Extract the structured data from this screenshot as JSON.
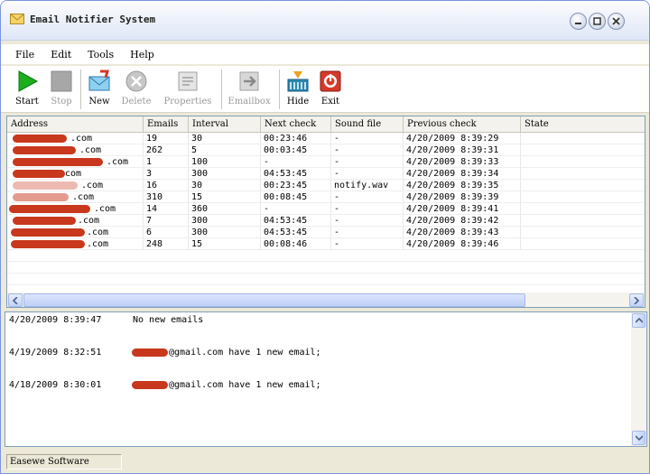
{
  "window": {
    "title": "Email Notifier System"
  },
  "menu": [
    "File",
    "Edit",
    "Tools",
    "Help"
  ],
  "toolbar": {
    "start": "Start",
    "stop": "Stop",
    "new": "New",
    "delete": "Delete",
    "properties": "Properties",
    "emailbox": "Emailbox",
    "hide": "Hide",
    "exit": "Exit"
  },
  "accounts": {
    "headers": [
      "Address",
      "Emails",
      "Interval",
      "Next check",
      "Sound file",
      "Previous check",
      "State"
    ],
    "rows": [
      {
        "address": ".com",
        "emails": "19",
        "interval": "30",
        "next": "00:23:46",
        "sound": "-",
        "prev": "4/20/2009 8:39:29",
        "state": ""
      },
      {
        "address": ".com",
        "emails": "262",
        "interval": "5",
        "next": "00:03:45",
        "sound": "-",
        "prev": "4/20/2009 8:39:31",
        "state": ""
      },
      {
        "address": ".com",
        "emails": "1",
        "interval": "100",
        "next": "-",
        "sound": "-",
        "prev": "4/20/2009 8:39:33",
        "state": ""
      },
      {
        "address": "com",
        "emails": "3",
        "interval": "300",
        "next": "04:53:45",
        "sound": "-",
        "prev": "4/20/2009 8:39:34",
        "state": ""
      },
      {
        "address": ".com",
        "emails": "16",
        "interval": "30",
        "next": "00:23:45",
        "sound": "notify.wav",
        "prev": "4/20/2009 8:39:35",
        "state": ""
      },
      {
        "address": ".com",
        "emails": "310",
        "interval": "15",
        "next": "00:08:45",
        "sound": "-",
        "prev": "4/20/2009 8:39:39",
        "state": ""
      },
      {
        "address": ".com",
        "emails": "14",
        "interval": "360",
        "next": "-",
        "sound": "-",
        "prev": "4/20/2009 8:39:41",
        "state": ""
      },
      {
        "address": ".com",
        "emails": "7",
        "interval": "300",
        "next": "04:53:45",
        "sound": "-",
        "prev": "4/20/2009 8:39:42",
        "state": ""
      },
      {
        "address": ".com",
        "emails": "6",
        "interval": "300",
        "next": "04:53:45",
        "sound": "-",
        "prev": "4/20/2009 8:39:43",
        "state": ""
      },
      {
        "address": ".com",
        "emails": "248",
        "interval": "15",
        "next": "00:08:46",
        "sound": "-",
        "prev": "4/20/2009 8:39:46",
        "state": ""
      }
    ]
  },
  "log": [
    {
      "time": "4/20/2009 8:39:47",
      "message": "No new emails"
    },
    {
      "time": "4/19/2009 8:32:51",
      "message": "@gmail.com have 1 new email;"
    },
    {
      "time": "4/18/2009 8:30:01",
      "message": "@gmail.com have 1 new email;"
    }
  ],
  "status": {
    "text": "Easewe Software"
  },
  "colors": {
    "redaction": "#c8381c",
    "start_green": "#1cae1c",
    "exit_red": "#d43a2a"
  }
}
